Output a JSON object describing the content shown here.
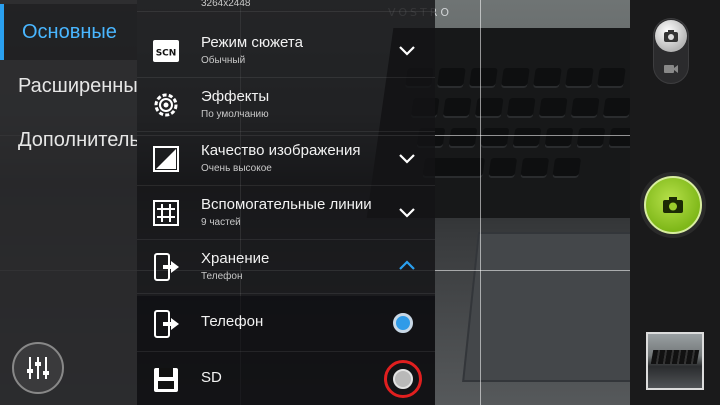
{
  "left_menu": {
    "items": [
      {
        "label": "Основные",
        "active": true
      },
      {
        "label": "Расширенные",
        "active": false
      },
      {
        "label": "Дополнительно",
        "active": false
      }
    ]
  },
  "settings": {
    "resolution_value": "3264x2448",
    "rows": [
      {
        "title": "Режим сюжета",
        "subtitle": "Обычный",
        "icon": "scene-mode-icon",
        "chevron": "down"
      },
      {
        "title": "Эффекты",
        "subtitle": "По умолчанию",
        "icon": "effects-gear-icon",
        "chevron": "none"
      },
      {
        "title": "Качество изображения",
        "subtitle": "Очень высокое",
        "icon": "image-quality-icon",
        "chevron": "down"
      },
      {
        "title": "Вспомогательные линии",
        "subtitle": "9 частей",
        "icon": "grid-lines-icon",
        "chevron": "down"
      },
      {
        "title": "Хранение",
        "subtitle": "Телефон",
        "icon": "storage-phone-icon",
        "chevron": "up"
      }
    ],
    "storage_options": [
      {
        "label": "Телефон",
        "selected": true,
        "icon": "phone-storage-icon"
      },
      {
        "label": "SD",
        "selected": false,
        "icon": "sd-card-icon"
      }
    ]
  },
  "viewfinder": {
    "brand_text": "VOSTRO"
  },
  "colors": {
    "accent_blue": "#2aa0f0",
    "shutter_green": "#7fb819",
    "highlight_red": "#e01f1f"
  },
  "controls": {
    "mode_photo_icon": "camera-icon",
    "mode_video_icon": "video-icon",
    "shutter_icon": "camera-icon",
    "settings_icon": "sliders-icon"
  }
}
